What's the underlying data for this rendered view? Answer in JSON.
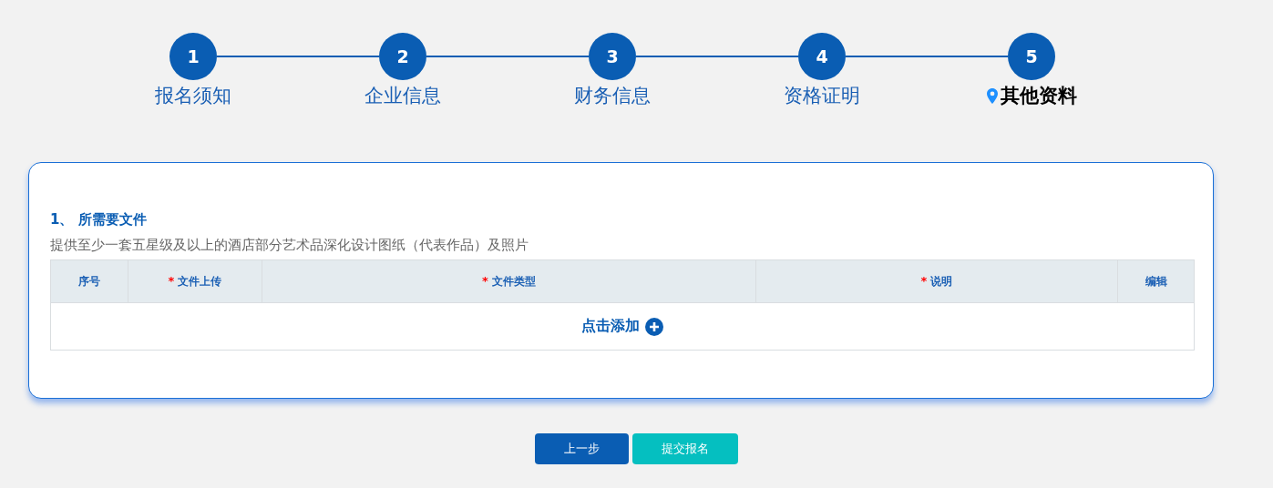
{
  "steps": [
    {
      "number": "1",
      "label": "报名须知",
      "selected": false
    },
    {
      "number": "2",
      "label": "企业信息",
      "selected": false
    },
    {
      "number": "3",
      "label": "财务信息",
      "selected": false
    },
    {
      "number": "4",
      "label": "资格证明",
      "selected": false
    },
    {
      "number": "5",
      "label": "其他资料",
      "selected": true
    }
  ],
  "section": {
    "title": "1、 所需要文件",
    "description": "提供至少一套五星级及以上的酒店部分艺术品深化设计图纸（代表作品）及照片",
    "table": {
      "columns": [
        {
          "label": "序号",
          "required": false
        },
        {
          "label": "文件上传",
          "required": true,
          "required_mark": "*"
        },
        {
          "label": "文件类型",
          "required": true,
          "required_mark": "*"
        },
        {
          "label": "说明",
          "required": true,
          "required_mark": "*"
        },
        {
          "label": "编辑",
          "required": false
        }
      ],
      "add_row": {
        "label": "点击添加"
      }
    }
  },
  "buttons": [
    {
      "label": "上一步",
      "kind": "secondary"
    },
    {
      "label": "提交报名",
      "kind": "primary"
    }
  ]
}
